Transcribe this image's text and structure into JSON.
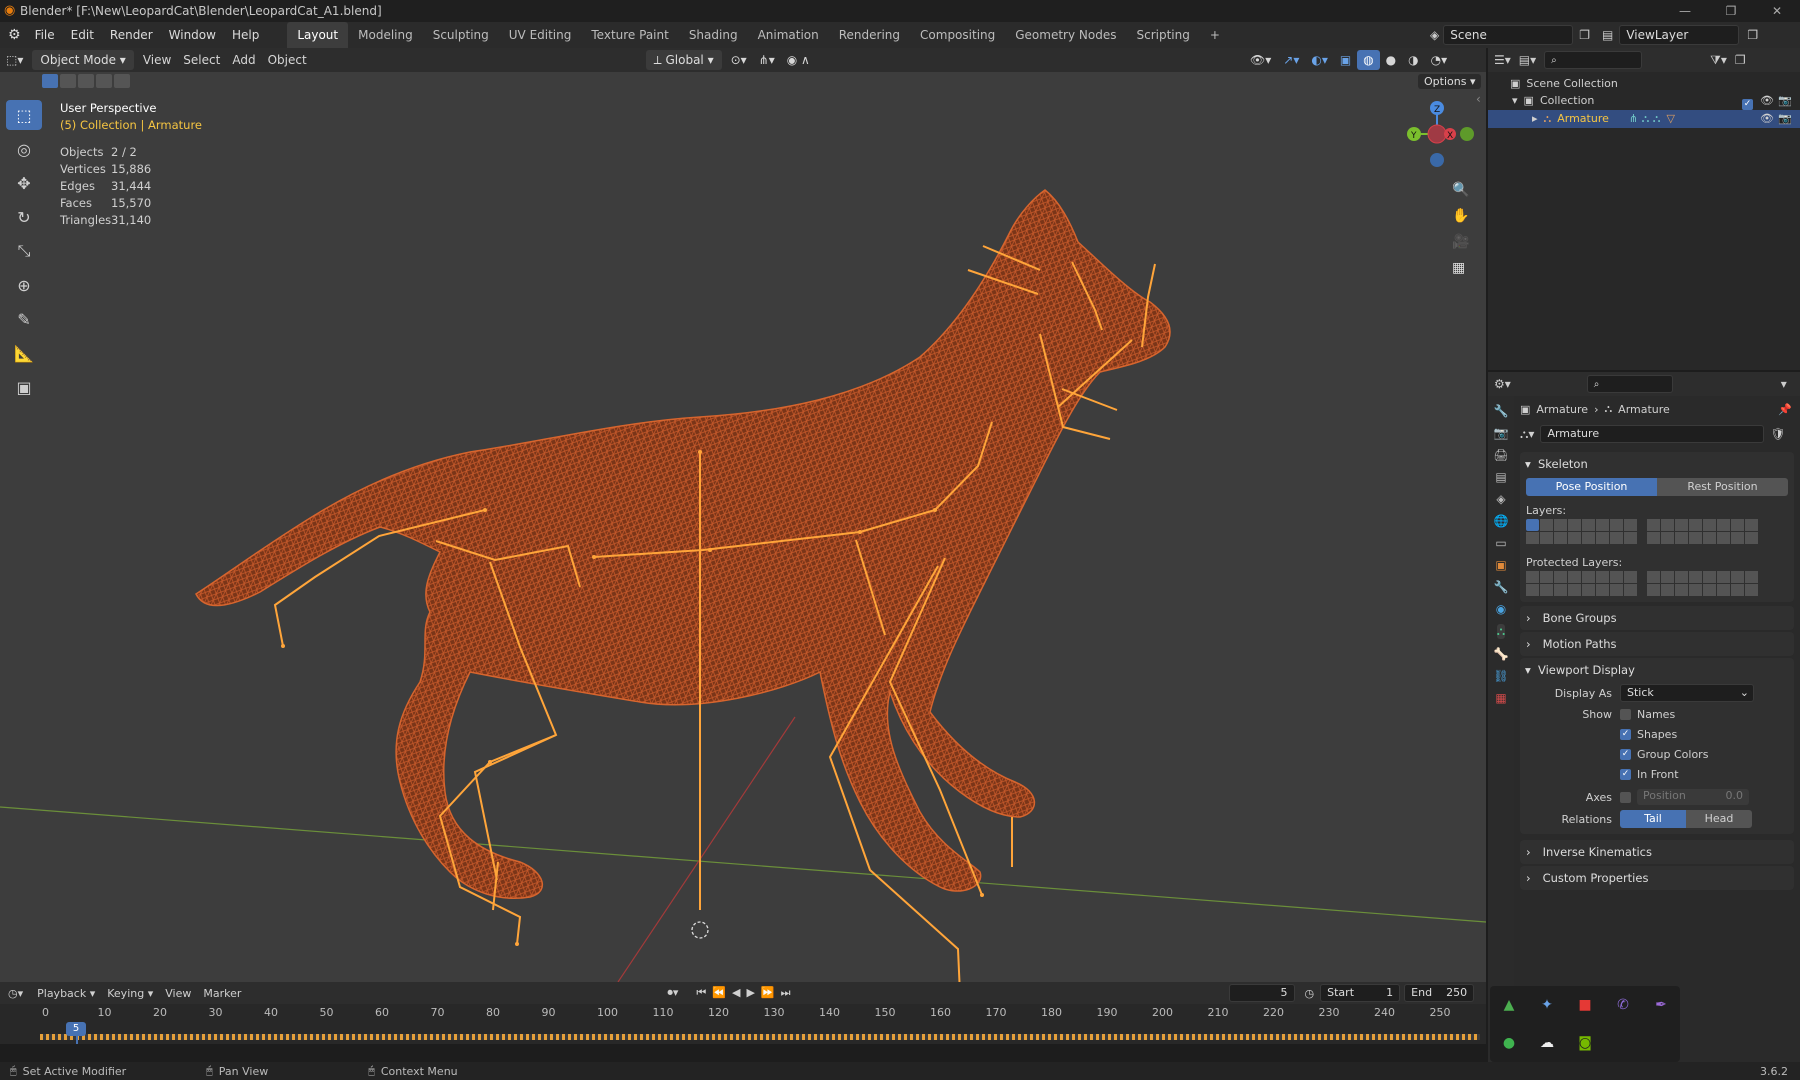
{
  "window": {
    "title": "Blender* [F:\\New\\LeopardCat\\Blender\\LeopardCat_A1.blend]"
  },
  "menu": [
    "File",
    "Edit",
    "Render",
    "Window",
    "Help"
  ],
  "workspaces": [
    "Layout",
    "Modeling",
    "Sculpting",
    "UV Editing",
    "Texture Paint",
    "Shading",
    "Animation",
    "Rendering",
    "Compositing",
    "Geometry Nodes",
    "Scripting"
  ],
  "active_workspace": "Layout",
  "scene": {
    "name": "Scene",
    "view_layer": "ViewLayer"
  },
  "viewport_header": {
    "mode": "Object Mode",
    "menus": [
      "View",
      "Select",
      "Add",
      "Object"
    ],
    "orientation": "Global",
    "options": "Options"
  },
  "viewport": {
    "perspective": "User Perspective",
    "context": "(5) Collection | Armature",
    "stats": [
      {
        "label": "Objects",
        "value": "2 / 2"
      },
      {
        "label": "Vertices",
        "value": "15,886"
      },
      {
        "label": "Edges",
        "value": "31,444"
      },
      {
        "label": "Faces",
        "value": "15,570"
      },
      {
        "label": "Triangles",
        "value": "31,140"
      }
    ],
    "gizmo": {
      "z": "Z",
      "y": "Y",
      "x": "X"
    }
  },
  "outliner": {
    "items": [
      {
        "label": "Scene Collection"
      },
      {
        "label": "Collection"
      },
      {
        "label": "Armature"
      }
    ]
  },
  "properties": {
    "breadcrumb": [
      "Armature",
      "Armature"
    ],
    "datablock": "Armature",
    "skeleton": {
      "title": "Skeleton",
      "pose_position": "Pose Position",
      "rest_position": "Rest Position",
      "layers_label": "Layers:",
      "protected_label": "Protected Layers:"
    },
    "collapsed_sections": [
      "Bone Groups",
      "Motion Paths"
    ],
    "viewport_display": {
      "title": "Viewport Display",
      "display_as_label": "Display As",
      "display_as": "Stick",
      "show_label": "Show",
      "names": "Names",
      "shapes": "Shapes",
      "group_colors": "Group Colors",
      "in_front": "In Front",
      "axes_label": "Axes",
      "position_label": "Position",
      "position_value": "0.0",
      "relations_label": "Relations",
      "tail": "Tail",
      "head": "Head"
    },
    "bottom_sections": [
      "Inverse Kinematics",
      "Custom Properties"
    ]
  },
  "timeline": {
    "menus": [
      "Playback",
      "Keying",
      "View",
      "Marker"
    ],
    "current_frame": "5",
    "start_label": "Start",
    "start": "1",
    "end_label": "End",
    "end": "250",
    "ticks": [
      "0",
      "10",
      "20",
      "30",
      "40",
      "50",
      "60",
      "70",
      "80",
      "90",
      "100",
      "110",
      "120",
      "130",
      "140",
      "150",
      "160",
      "170",
      "180",
      "190",
      "200",
      "210",
      "220",
      "230",
      "240",
      "250"
    ]
  },
  "statusbar": {
    "hint1": "Set Active Modifier",
    "hint2": "Pan View",
    "hint3": "Context Menu",
    "version": "3.6.2"
  },
  "colors": {
    "accent": "#4772b3",
    "mesh": "#c45a2a",
    "bone": "#ffa53a",
    "selected_text": "#f5c542"
  }
}
